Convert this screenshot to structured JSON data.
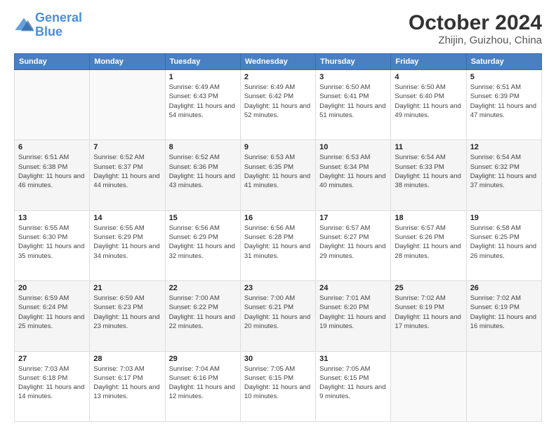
{
  "logo": {
    "line1": "General",
    "line2": "Blue"
  },
  "title": "October 2024",
  "subtitle": "Zhijin, Guizhou, China",
  "days_of_week": [
    "Sunday",
    "Monday",
    "Tuesday",
    "Wednesday",
    "Thursday",
    "Friday",
    "Saturday"
  ],
  "weeks": [
    [
      {
        "day": "",
        "info": ""
      },
      {
        "day": "",
        "info": ""
      },
      {
        "day": "1",
        "info": "Sunrise: 6:49 AM\nSunset: 6:43 PM\nDaylight: 11 hours and 54 minutes."
      },
      {
        "day": "2",
        "info": "Sunrise: 6:49 AM\nSunset: 6:42 PM\nDaylight: 11 hours and 52 minutes."
      },
      {
        "day": "3",
        "info": "Sunrise: 6:50 AM\nSunset: 6:41 PM\nDaylight: 11 hours and 51 minutes."
      },
      {
        "day": "4",
        "info": "Sunrise: 6:50 AM\nSunset: 6:40 PM\nDaylight: 11 hours and 49 minutes."
      },
      {
        "day": "5",
        "info": "Sunrise: 6:51 AM\nSunset: 6:39 PM\nDaylight: 11 hours and 47 minutes."
      }
    ],
    [
      {
        "day": "6",
        "info": "Sunrise: 6:51 AM\nSunset: 6:38 PM\nDaylight: 11 hours and 46 minutes."
      },
      {
        "day": "7",
        "info": "Sunrise: 6:52 AM\nSunset: 6:37 PM\nDaylight: 11 hours and 44 minutes."
      },
      {
        "day": "8",
        "info": "Sunrise: 6:52 AM\nSunset: 6:36 PM\nDaylight: 11 hours and 43 minutes."
      },
      {
        "day": "9",
        "info": "Sunrise: 6:53 AM\nSunset: 6:35 PM\nDaylight: 11 hours and 41 minutes."
      },
      {
        "day": "10",
        "info": "Sunrise: 6:53 AM\nSunset: 6:34 PM\nDaylight: 11 hours and 40 minutes."
      },
      {
        "day": "11",
        "info": "Sunrise: 6:54 AM\nSunset: 6:33 PM\nDaylight: 11 hours and 38 minutes."
      },
      {
        "day": "12",
        "info": "Sunrise: 6:54 AM\nSunset: 6:32 PM\nDaylight: 11 hours and 37 minutes."
      }
    ],
    [
      {
        "day": "13",
        "info": "Sunrise: 6:55 AM\nSunset: 6:30 PM\nDaylight: 11 hours and 35 minutes."
      },
      {
        "day": "14",
        "info": "Sunrise: 6:55 AM\nSunset: 6:29 PM\nDaylight: 11 hours and 34 minutes."
      },
      {
        "day": "15",
        "info": "Sunrise: 6:56 AM\nSunset: 6:29 PM\nDaylight: 11 hours and 32 minutes."
      },
      {
        "day": "16",
        "info": "Sunrise: 6:56 AM\nSunset: 6:28 PM\nDaylight: 11 hours and 31 minutes."
      },
      {
        "day": "17",
        "info": "Sunrise: 6:57 AM\nSunset: 6:27 PM\nDaylight: 11 hours and 29 minutes."
      },
      {
        "day": "18",
        "info": "Sunrise: 6:57 AM\nSunset: 6:26 PM\nDaylight: 11 hours and 28 minutes."
      },
      {
        "day": "19",
        "info": "Sunrise: 6:58 AM\nSunset: 6:25 PM\nDaylight: 11 hours and 26 minutes."
      }
    ],
    [
      {
        "day": "20",
        "info": "Sunrise: 6:59 AM\nSunset: 6:24 PM\nDaylight: 11 hours and 25 minutes."
      },
      {
        "day": "21",
        "info": "Sunrise: 6:59 AM\nSunset: 6:23 PM\nDaylight: 11 hours and 23 minutes."
      },
      {
        "day": "22",
        "info": "Sunrise: 7:00 AM\nSunset: 6:22 PM\nDaylight: 11 hours and 22 minutes."
      },
      {
        "day": "23",
        "info": "Sunrise: 7:00 AM\nSunset: 6:21 PM\nDaylight: 11 hours and 20 minutes."
      },
      {
        "day": "24",
        "info": "Sunrise: 7:01 AM\nSunset: 6:20 PM\nDaylight: 11 hours and 19 minutes."
      },
      {
        "day": "25",
        "info": "Sunrise: 7:02 AM\nSunset: 6:19 PM\nDaylight: 11 hours and 17 minutes."
      },
      {
        "day": "26",
        "info": "Sunrise: 7:02 AM\nSunset: 6:19 PM\nDaylight: 11 hours and 16 minutes."
      }
    ],
    [
      {
        "day": "27",
        "info": "Sunrise: 7:03 AM\nSunset: 6:18 PM\nDaylight: 11 hours and 14 minutes."
      },
      {
        "day": "28",
        "info": "Sunrise: 7:03 AM\nSunset: 6:17 PM\nDaylight: 11 hours and 13 minutes."
      },
      {
        "day": "29",
        "info": "Sunrise: 7:04 AM\nSunset: 6:16 PM\nDaylight: 11 hours and 12 minutes."
      },
      {
        "day": "30",
        "info": "Sunrise: 7:05 AM\nSunset: 6:15 PM\nDaylight: 11 hours and 10 minutes."
      },
      {
        "day": "31",
        "info": "Sunrise: 7:05 AM\nSunset: 6:15 PM\nDaylight: 11 hours and 9 minutes."
      },
      {
        "day": "",
        "info": ""
      },
      {
        "day": "",
        "info": ""
      }
    ]
  ]
}
